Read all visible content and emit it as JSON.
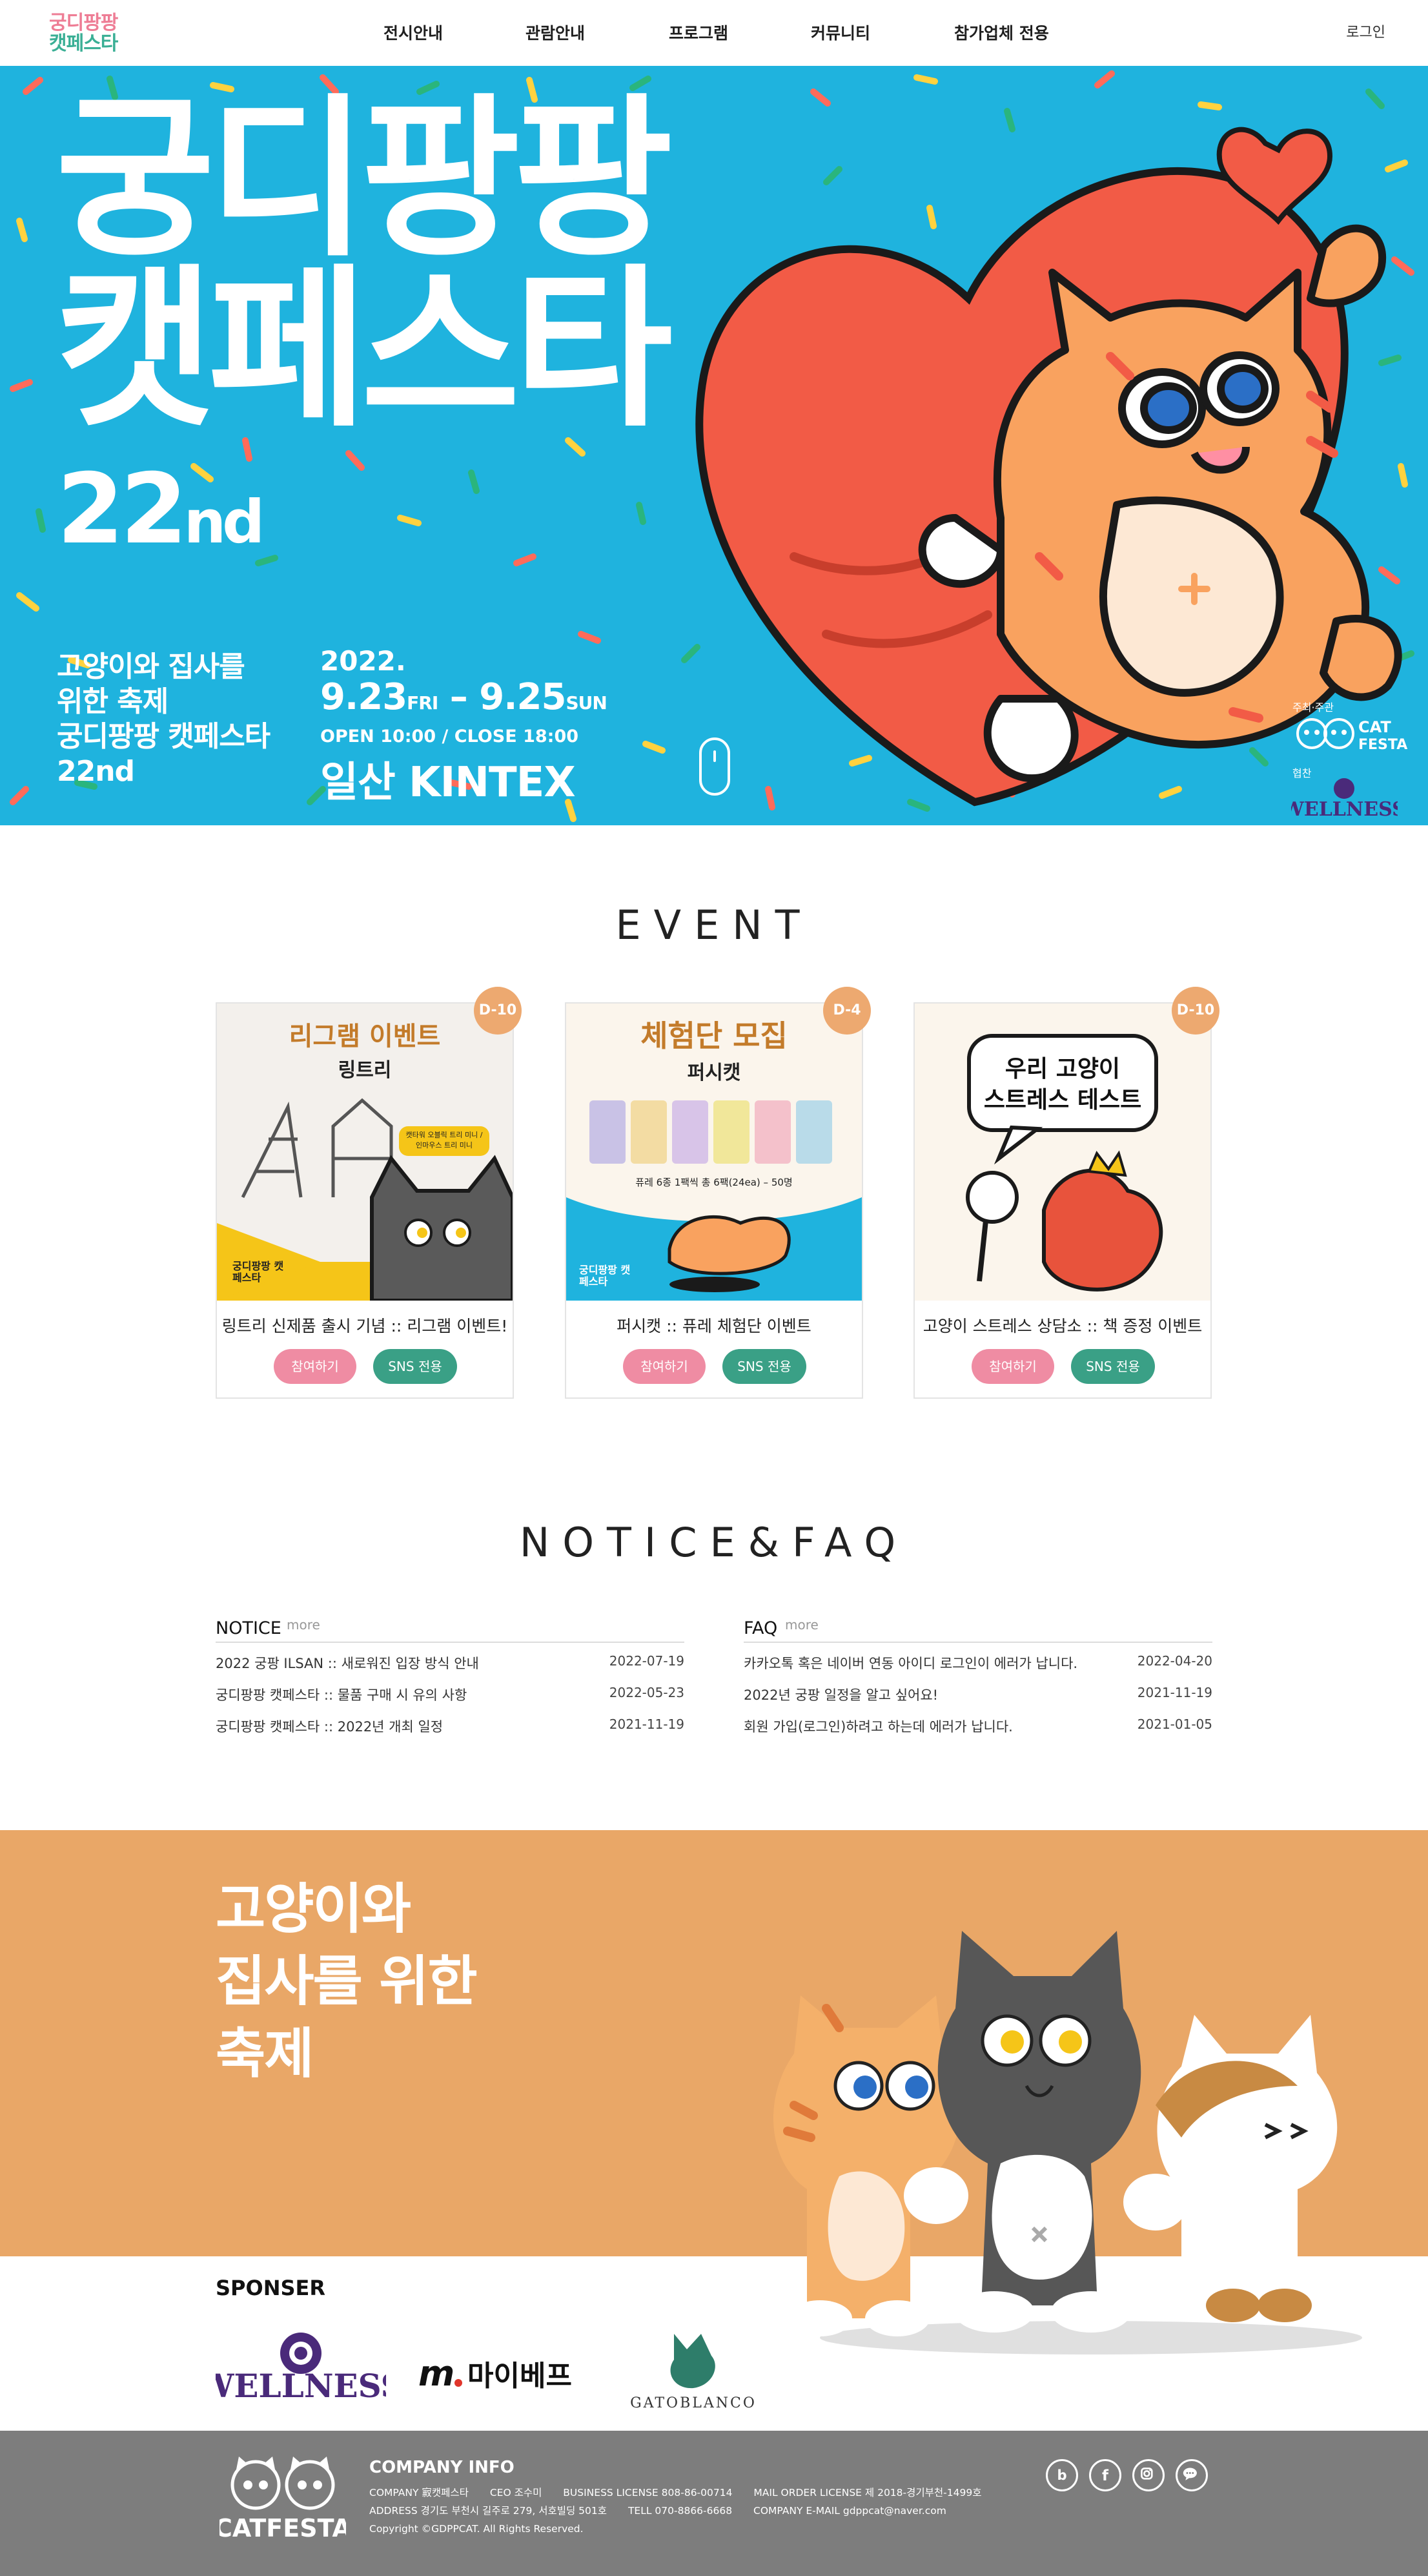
{
  "header": {
    "logo_line1": "궁디팡팡",
    "logo_line2": "캣페스타",
    "nav": [
      "전시안내",
      "관람안내",
      "프로그램",
      "커뮤니티",
      "참가업체 전용"
    ],
    "login": "로그인"
  },
  "hero": {
    "title_line1": "궁디팡팡",
    "title_line2": "캣페스타",
    "reg_mark": "®",
    "edition_num": "22",
    "edition_suffix": "nd",
    "subtitle": [
      "고양이와 집사를",
      "위한 축제",
      "궁디팡팡 캣페스타",
      "22nd"
    ],
    "year": "2022.",
    "start": "9.23",
    "start_day": "FRI",
    "dash": " – ",
    "end": "9.25",
    "end_day": "SUN",
    "hours": "OPEN 10:00 / CLOSE 18:00",
    "venue": "일산 KINTEX",
    "host_label": "주최·주관",
    "sponsor_label": "협찬",
    "host_logo_text": "CAT FESTA",
    "wellness_text": "WELLNESS"
  },
  "event": {
    "heading": "EVENT",
    "cards": [
      {
        "dday": "D-10",
        "title": "링트리 신제품 출시 기념 :: 리그램 이벤트!",
        "img_heading": "리그램 이벤트",
        "img_sub": "링트리",
        "img_tag": "캣타워 오블릭 트리 미니 / 인마우스 트리 미니",
        "img_corner": "궁디팡팡 캣페스타",
        "join": "참여하기",
        "sns": "SNS 전용"
      },
      {
        "dday": "D-4",
        "title": "퍼시캣 :: 퓨레 체험단 이벤트",
        "img_heading": "체험단 모집",
        "img_sub": "퍼시캣",
        "img_tag": "퓨레 6종 1팩씩 총 6팩(24ea) – 50명",
        "img_corner": "궁디팡팡 캣페스타",
        "join": "참여하기",
        "sns": "SNS 전용"
      },
      {
        "dday": "D-10",
        "title": "고양이 스트레스 상담소 :: 책 증정 이벤트",
        "img_heading": "우리 고양이",
        "img_sub": "스트레스 테스트",
        "join": "참여하기",
        "sns": "SNS 전용"
      }
    ]
  },
  "board": {
    "heading": "NOTICE&FAQ",
    "notice": {
      "name": "NOTICE",
      "more": "more",
      "rows": [
        {
          "title": "2022 궁팡 ILSAN :: 새로워진 입장 방식 안내",
          "date": "2022-07-19"
        },
        {
          "title": "궁디팡팡 캣페스타 :: 물품 구매 시 유의 사항",
          "date": "2022-05-23"
        },
        {
          "title": "궁디팡팡 캣페스타 :: 2022년 개최 일정",
          "date": "2021-11-19"
        }
      ]
    },
    "faq": {
      "name": "FAQ",
      "more": "more",
      "rows": [
        {
          "title": "카카오톡 혹은 네이버 연동 아이디 로그인이 에러가 납니다.",
          "date": "2022-04-20"
        },
        {
          "title": "2022년 궁팡 일정을 알고 싶어요!",
          "date": "2021-11-19"
        },
        {
          "title": "회원 가입(로그인)하려고 하는데 에러가 납니다.",
          "date": "2021-01-05"
        }
      ]
    }
  },
  "festival": {
    "text": "고양이와\n집사를 위한\n축제"
  },
  "sponsor": {
    "heading": "SPONSER",
    "logos": [
      "WELLNESS",
      "마이베프",
      "GATOBLANCO"
    ]
  },
  "footer": {
    "logo_text": "CATFESTA",
    "title": "COMPANY INFO",
    "line1": [
      "COMPANY 㝮캣페스타",
      "CEO 조수미",
      "BUSINESS LICENSE 808-86-00714",
      "MAIL ORDER LICENSE 제 2018-경기부천-1499호"
    ],
    "line2": [
      "ADDRESS 경기도 부천시 길주로 279, 서호빌딩 501호",
      "TELL 070-8866-6668",
      "COMPANY E-MAIL gdppcat@naver.com"
    ],
    "copyright": "Copyright ©GDPPCAT. All Rights Reserved.",
    "social": [
      "blog-icon",
      "facebook-icon",
      "instagram-icon",
      "kakaotalk-icon"
    ]
  },
  "colors": {
    "hero_bg": "#1fb3de",
    "accent_orange": "#e9a767",
    "join_pink": "#ef8ca3",
    "sns_green": "#3aa086",
    "footer_gray": "#7d7d7d"
  }
}
